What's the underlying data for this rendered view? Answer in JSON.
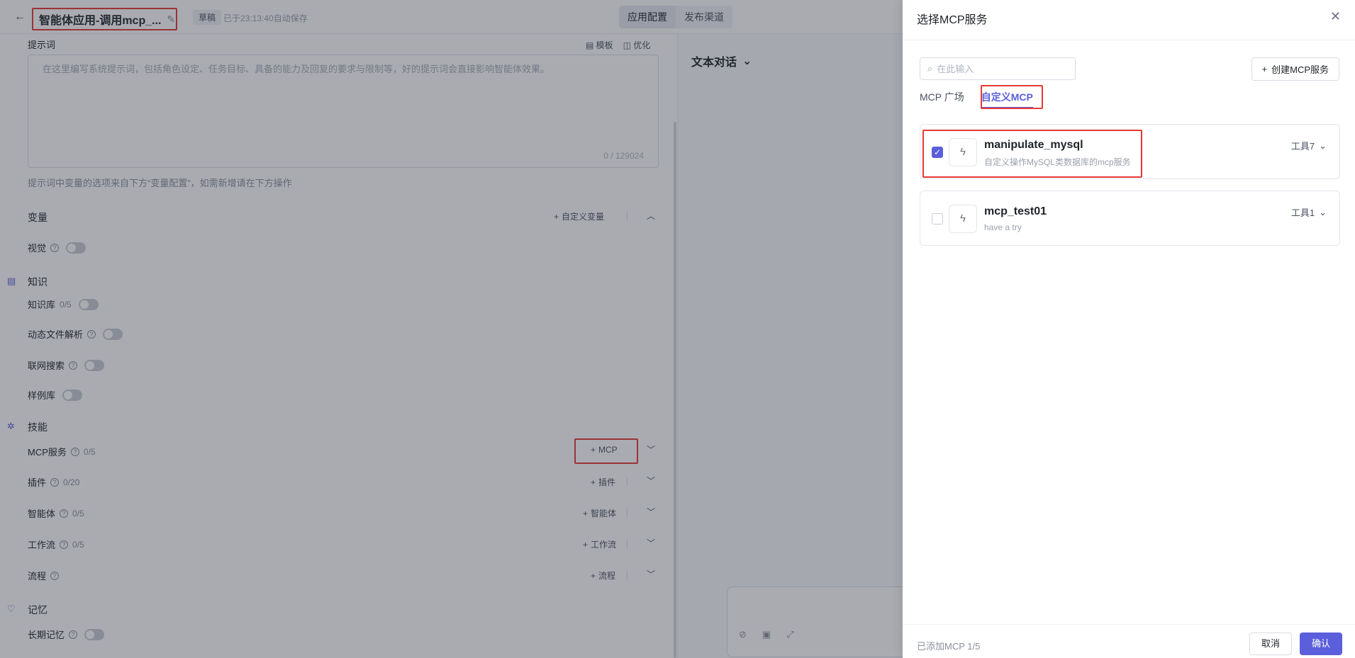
{
  "header": {
    "back_icon": "arrow-left-icon",
    "app_title": "智能体应用-调用mcp_...",
    "status_badge": "草稿",
    "autosave_text": "已于23:13:40自动保存",
    "tabs": [
      "应用配置",
      "发布渠道"
    ]
  },
  "prompt": {
    "label": "提示词",
    "template_label": "模板",
    "optimize_label": "优化",
    "placeholder": "在这里编写系统提示词，包括角色设定、任务目标、具备的能力及回复的要求与限制等，好的提示词会直接影响智能体效果。",
    "counter": "0 / 129024",
    "hint": "提示词中变量的选项来自下方“变量配置”，如需新增请在下方操作"
  },
  "variables": {
    "title": "变量",
    "add_label": "自定义变量",
    "vision_label": "视觉"
  },
  "knowledge": {
    "title": "知识",
    "kb_label": "知识库",
    "kb_count": "0/5",
    "dynamic_file_label": "动态文件解析",
    "web_search_label": "联网搜索",
    "example_lib_label": "样例库"
  },
  "skills": {
    "title": "技能",
    "items": [
      {
        "label": "MCP服务",
        "count": "0/5",
        "add": "MCP"
      },
      {
        "label": "插件",
        "count": "0/20",
        "add": "插件"
      },
      {
        "label": "智能体",
        "count": "0/5",
        "add": "智能体"
      },
      {
        "label": "工作流",
        "count": "0/5",
        "add": "工作流"
      },
      {
        "label": "流程",
        "count": "",
        "add": "流程"
      }
    ]
  },
  "memory": {
    "title": "记忆",
    "long_term_label": "长期记忆"
  },
  "chat": {
    "mode_label": "文本对话"
  },
  "drawer": {
    "title": "选择MCP服务",
    "search_placeholder": "在此输入",
    "create_button": "创建MCP服务",
    "tabs": [
      "MCP 广场",
      "自定义MCP"
    ],
    "active_tab": "自定义MCP",
    "services": [
      {
        "name": "manipulate_mysql",
        "desc": "自定义操作MySQL类数据库的mcp服务",
        "tools": "工具7",
        "checked": true
      },
      {
        "name": "mcp_test01",
        "desc": "have a try",
        "tools": "工具1",
        "checked": false
      }
    ],
    "footer_text": "已添加MCP 1/5",
    "cancel_label": "取消",
    "confirm_label": "确认"
  },
  "colors": {
    "accent": "#5b5fdb",
    "highlight_box": "#e53935"
  }
}
